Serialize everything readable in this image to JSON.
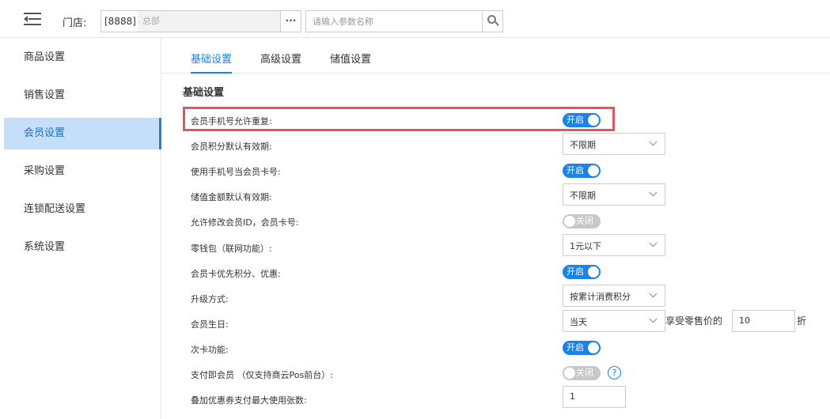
{
  "header": {
    "store_label": "门店:",
    "store_code": "[8888]",
    "store_name": "总部",
    "more_label": "···",
    "search_placeholder": "请输入参数名称"
  },
  "sidebar": {
    "items": [
      {
        "label": "商品设置"
      },
      {
        "label": "销售设置"
      },
      {
        "label": "会员设置",
        "active": true
      },
      {
        "label": "采购设置"
      },
      {
        "label": "连锁配送设置"
      },
      {
        "label": "系统设置"
      }
    ]
  },
  "tabs": [
    {
      "label": "基础设置",
      "active": true
    },
    {
      "label": "高级设置"
    },
    {
      "label": "储值设置"
    }
  ],
  "section_title": "基础设置",
  "settings": [
    {
      "label": "会员手机号允许重复:",
      "control": "toggle",
      "value": "开启",
      "on": true,
      "highlighted": true
    },
    {
      "label": "会员积分默认有效期:",
      "control": "select",
      "value": "不限期"
    },
    {
      "label": "使用手机号当会员卡号:",
      "control": "toggle",
      "value": "开启",
      "on": true
    },
    {
      "label": "储值金额默认有效期:",
      "control": "select",
      "value": "不限期"
    },
    {
      "label": "允许修改会员ID，会员卡号:",
      "control": "toggle",
      "value": "关闭",
      "on": false
    },
    {
      "label": "零钱包（联网功能）:",
      "control": "select",
      "value": "1元以下"
    },
    {
      "label": "会员卡优先积分、优惠:",
      "control": "toggle",
      "value": "开启",
      "on": true
    },
    {
      "label": "升级方式:",
      "control": "select",
      "value": "按累计消费积分"
    },
    {
      "label": "会员生日:",
      "control": "select",
      "value": "当天",
      "suffix_before": "享受零售价的",
      "discount": "10",
      "suffix_after": "折"
    },
    {
      "label": "次卡功能:",
      "control": "toggle",
      "value": "开启",
      "on": true
    },
    {
      "label": "支付即会员 （仅支持商云Pos前台）:",
      "control": "toggle",
      "value": "关闭",
      "on": false,
      "help": "?"
    },
    {
      "label": "叠加优惠券支付最大使用张数:",
      "control": "input",
      "value": "1"
    }
  ],
  "colors": {
    "accent": "#1a82e8",
    "highlight_border": "#e0575b",
    "sidebar_active_bg": "#c5dff8",
    "toggle_off": "#c8c8c8"
  }
}
